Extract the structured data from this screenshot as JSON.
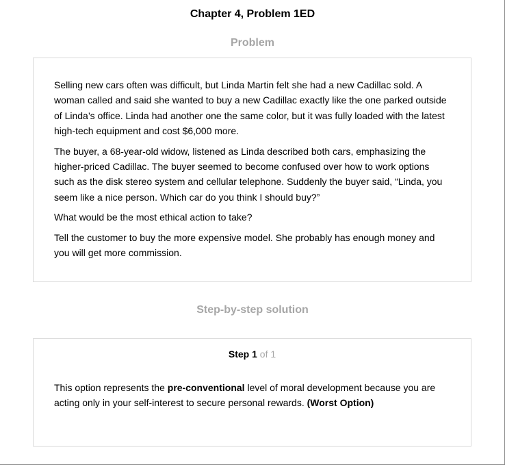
{
  "chapter_title": "Chapter 4, Problem 1ED",
  "problem_heading": "Problem",
  "problem": {
    "paragraphs": [
      "Selling new cars often was difficult, but Linda Martin felt she had a new Cadillac sold. A woman called and said she wanted to buy a new Cadillac exactly like the one parked outside of Linda’s office. Linda had another one the same color, but it was fully loaded with the latest high-tech equipment and cost $6,000 more.",
      "The buyer, a 68-year-old widow, listened as Linda described both cars, emphasizing the higher-priced Cadillac. The buyer seemed to become confused over how to work options such as the disk stereo system and cellular telephone. Suddenly the buyer said, “Linda, you seem like a nice person. Which car do you think I should buy?”",
      "What would be the most ethical action to take?",
      "Tell the customer to buy the more expensive model. She probably has enough money and you will get more commission."
    ]
  },
  "solution_heading": "Step-by-step solution",
  "solution": {
    "step_word": "Step",
    "step_number": "1",
    "step_total": "of 1",
    "text_before": "This option represents the ",
    "bold_term": "pre-conventional",
    "text_middle": " level of moral development because you are acting only in your self-interest to secure personal rewards. ",
    "bold_rating": "(Worst Option)"
  }
}
